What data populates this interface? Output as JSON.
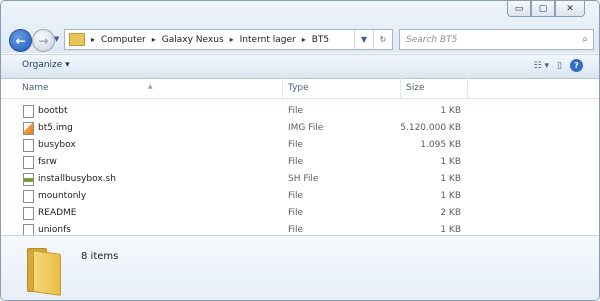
{
  "window": {
    "caption_buttons": {
      "minimize": "▭",
      "maximize": "▢",
      "close": "✕"
    }
  },
  "nav": {
    "back_glyph": "←",
    "forward_glyph": "→",
    "recent_glyph": "▼"
  },
  "address": {
    "crumbs": [
      "Computer",
      "Galaxy Nexus",
      "Internt lager",
      "BT5"
    ],
    "dropdown_glyph": "▼",
    "refresh_glyph": "↻"
  },
  "search": {
    "placeholder": "Search BT5",
    "icon": "search-icon"
  },
  "toolbar": {
    "organize_label": "Organize ▾",
    "views_glyph": "☷ ▾",
    "preview_pane_glyph": "▯",
    "help_glyph": "?"
  },
  "columns": {
    "name": "Name",
    "type": "Type",
    "size": "Size",
    "sort_glyph": "▲"
  },
  "files": [
    {
      "name": "bootbt",
      "type": "File",
      "size": "1 KB",
      "icon": "file-icon"
    },
    {
      "name": "bt5.img",
      "type": "IMG File",
      "size": "5.120.000 KB",
      "icon": "img-file-icon"
    },
    {
      "name": "busybox",
      "type": "File",
      "size": "1.095 KB",
      "icon": "file-icon"
    },
    {
      "name": "fsrw",
      "type": "File",
      "size": "1 KB",
      "icon": "file-icon"
    },
    {
      "name": "installbusybox.sh",
      "type": "SH File",
      "size": "1 KB",
      "icon": "sh-file-icon"
    },
    {
      "name": "mountonly",
      "type": "File",
      "size": "1 KB",
      "icon": "file-icon"
    },
    {
      "name": "README",
      "type": "File",
      "size": "2 KB",
      "icon": "file-icon"
    },
    {
      "name": "unionfs",
      "type": "File",
      "size": "1 KB",
      "icon": "file-icon"
    }
  ],
  "details": {
    "item_count": "8 items"
  },
  "colors": {
    "titlebar": "#dfe9f5",
    "accent": "#1c56b6",
    "folder": "#e8bf45"
  }
}
